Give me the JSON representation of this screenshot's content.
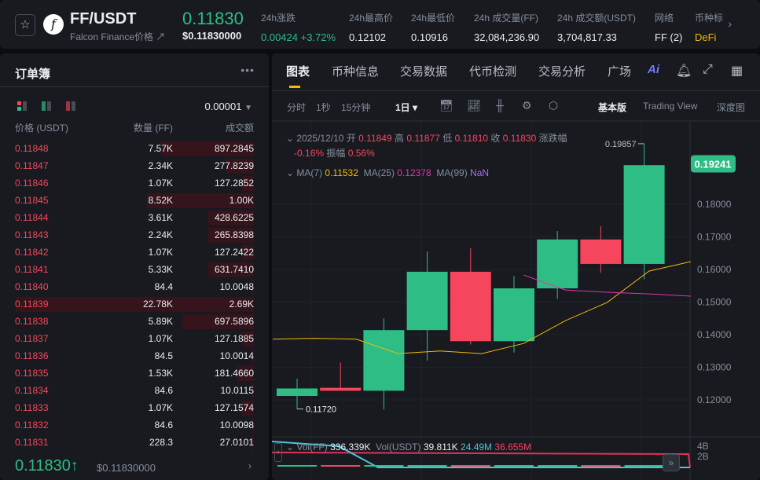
{
  "header": {
    "symbol": "FF/USDT",
    "name": "Falcon Finance价格 ↗",
    "last_price": "0.11830",
    "last_price_usd": "$0.11830000",
    "stats": [
      {
        "label": "24h涨跌",
        "value": "0.00424 +3.72%",
        "color": "#2ebd85"
      },
      {
        "label": "24h最高价",
        "value": "0.12102"
      },
      {
        "label": "24h最低价",
        "value": "0.10916"
      },
      {
        "label": "24h 成交量(FF)",
        "value": "32,084,236.90"
      },
      {
        "label": "24h 成交额(USDT)",
        "value": "3,704,817.33"
      },
      {
        "label": "网络",
        "value": "FF (2)"
      },
      {
        "label": "币种标",
        "value": "DeFi",
        "color": "#f0b90b"
      }
    ]
  },
  "orderbook": {
    "title": "订单簿",
    "precision": "0.00001",
    "col_price": "价格 (USDT)",
    "col_qty": "数量 (FF)",
    "col_amount": "成交额",
    "asks": [
      {
        "price": "0.11848",
        "qty": "7.57K",
        "amount": "897.2845",
        "depth": 0.39
      },
      {
        "price": "0.11847",
        "qty": "2.34K",
        "amount": "277.8239",
        "depth": 0.12
      },
      {
        "price": "0.11846",
        "qty": "1.07K",
        "amount": "127.2852",
        "depth": 0.05
      },
      {
        "price": "0.11845",
        "qty": "8.52K",
        "amount": "1.00K",
        "depth": 0.45
      },
      {
        "price": "0.11844",
        "qty": "3.61K",
        "amount": "428.6225",
        "depth": 0.19
      },
      {
        "price": "0.11843",
        "qty": "2.24K",
        "amount": "265.8398",
        "depth": 0.19
      },
      {
        "price": "0.11842",
        "qty": "1.07K",
        "amount": "127.2422",
        "depth": 0.05
      },
      {
        "price": "0.11841",
        "qty": "5.33K",
        "amount": "631.7410",
        "depth": 0.19
      },
      {
        "price": "0.11840",
        "qty": "84.4",
        "amount": "10.0048",
        "depth": 0.01
      },
      {
        "price": "0.11839",
        "qty": "22.78K",
        "amount": "2.69K",
        "depth": 1.0
      },
      {
        "price": "0.11838",
        "qty": "5.89K",
        "amount": "697.5896",
        "depth": 0.3
      },
      {
        "price": "0.11837",
        "qty": "1.07K",
        "amount": "127.1885",
        "depth": 0.05
      },
      {
        "price": "0.11836",
        "qty": "84.5",
        "amount": "10.0014",
        "depth": 0.01
      },
      {
        "price": "0.11835",
        "qty": "1.53K",
        "amount": "181.4660",
        "depth": 0.07
      },
      {
        "price": "0.11834",
        "qty": "84.6",
        "amount": "10.0115",
        "depth": 0.01
      },
      {
        "price": "0.11833",
        "qty": "1.07K",
        "amount": "127.1574",
        "depth": 0.05
      },
      {
        "price": "0.11832",
        "qty": "84.6",
        "amount": "10.0098",
        "depth": 0.01
      },
      {
        "price": "0.11831",
        "qty": "228.3",
        "amount": "27.0101",
        "depth": 0.01
      }
    ],
    "last_price": "0.11830↑",
    "last_price_usd": "$0.11830000"
  },
  "chart": {
    "tabs": [
      "图表",
      "币种信息",
      "交易数据",
      "代币检测",
      "交易分析",
      "广场"
    ],
    "ai_label": "Ai",
    "intervals": [
      "分时",
      "1秒",
      "15分钟"
    ],
    "interval_selected": "1日 ▾",
    "views": [
      "基本版",
      "Trading View",
      "深度图"
    ],
    "ohlc": {
      "date": "2025/12/10",
      "open_l": "开",
      "open": "0.11849",
      "high_l": "高",
      "high": "0.11877",
      "low_l": "低",
      "low": "0.11810",
      "close_l": "收",
      "close": "0.11830",
      "chg_l": "涨跌幅",
      "chg": "-0.16%",
      "amp_l": "振幅",
      "amp": "0.56%"
    },
    "ma": {
      "ma7_l": "MA(7)",
      "ma7": "0.11532",
      "ma25_l": "MA(25)",
      "ma25": "0.12378",
      "ma99_l": "MA(99)",
      "ma99": "NaN"
    },
    "vol": {
      "ff_l": "Vol(FF)",
      "ff": "336.339K",
      "usdt_l": "Vol(USDT)",
      "usdt": "39.811K",
      "v1": "24.49M",
      "v2": "36.655M",
      "axis": [
        "4B",
        "2B"
      ]
    }
  },
  "chart_data": {
    "type": "candlestick",
    "y_ticks": [
      "0.18000",
      "0.17000",
      "0.16000",
      "0.15000",
      "0.14000",
      "0.13000",
      "0.12000"
    ],
    "candles": [
      [
        0.1212,
        0.1265,
        0.1172,
        0.1235
      ],
      [
        0.1237,
        0.1315,
        0.1228,
        0.1228
      ],
      [
        0.1228,
        0.145,
        0.117,
        0.1414
      ],
      [
        0.1414,
        0.1655,
        0.132,
        0.1593
      ],
      [
        0.1593,
        0.1665,
        0.137,
        0.138
      ],
      [
        0.138,
        0.158,
        0.1345,
        0.1542
      ],
      [
        0.1542,
        0.1718,
        0.151,
        0.1692
      ],
      [
        0.1692,
        0.1733,
        0.159,
        0.1617
      ],
      [
        0.1617,
        0.19857,
        0.157,
        0.192
      ]
    ],
    "high_label": "0.19857",
    "low_label": "0.11720",
    "last_label": "0.19241",
    "ma7": [
      0.1386,
      0.1389,
      0.1386,
      0.1342,
      0.135,
      0.1342,
      0.1373,
      0.1443,
      0.1499,
      0.1595,
      0.1624
    ],
    "ma25": [
      null,
      null,
      null,
      null,
      null,
      null,
      0.1583,
      0.1537,
      0.153,
      0.1525,
      0.1518
    ],
    "colors": {
      "up": "#2ebd85",
      "down": "#f6465d",
      "ma7": "#f0b90b",
      "ma25": "#e033b0"
    }
  }
}
